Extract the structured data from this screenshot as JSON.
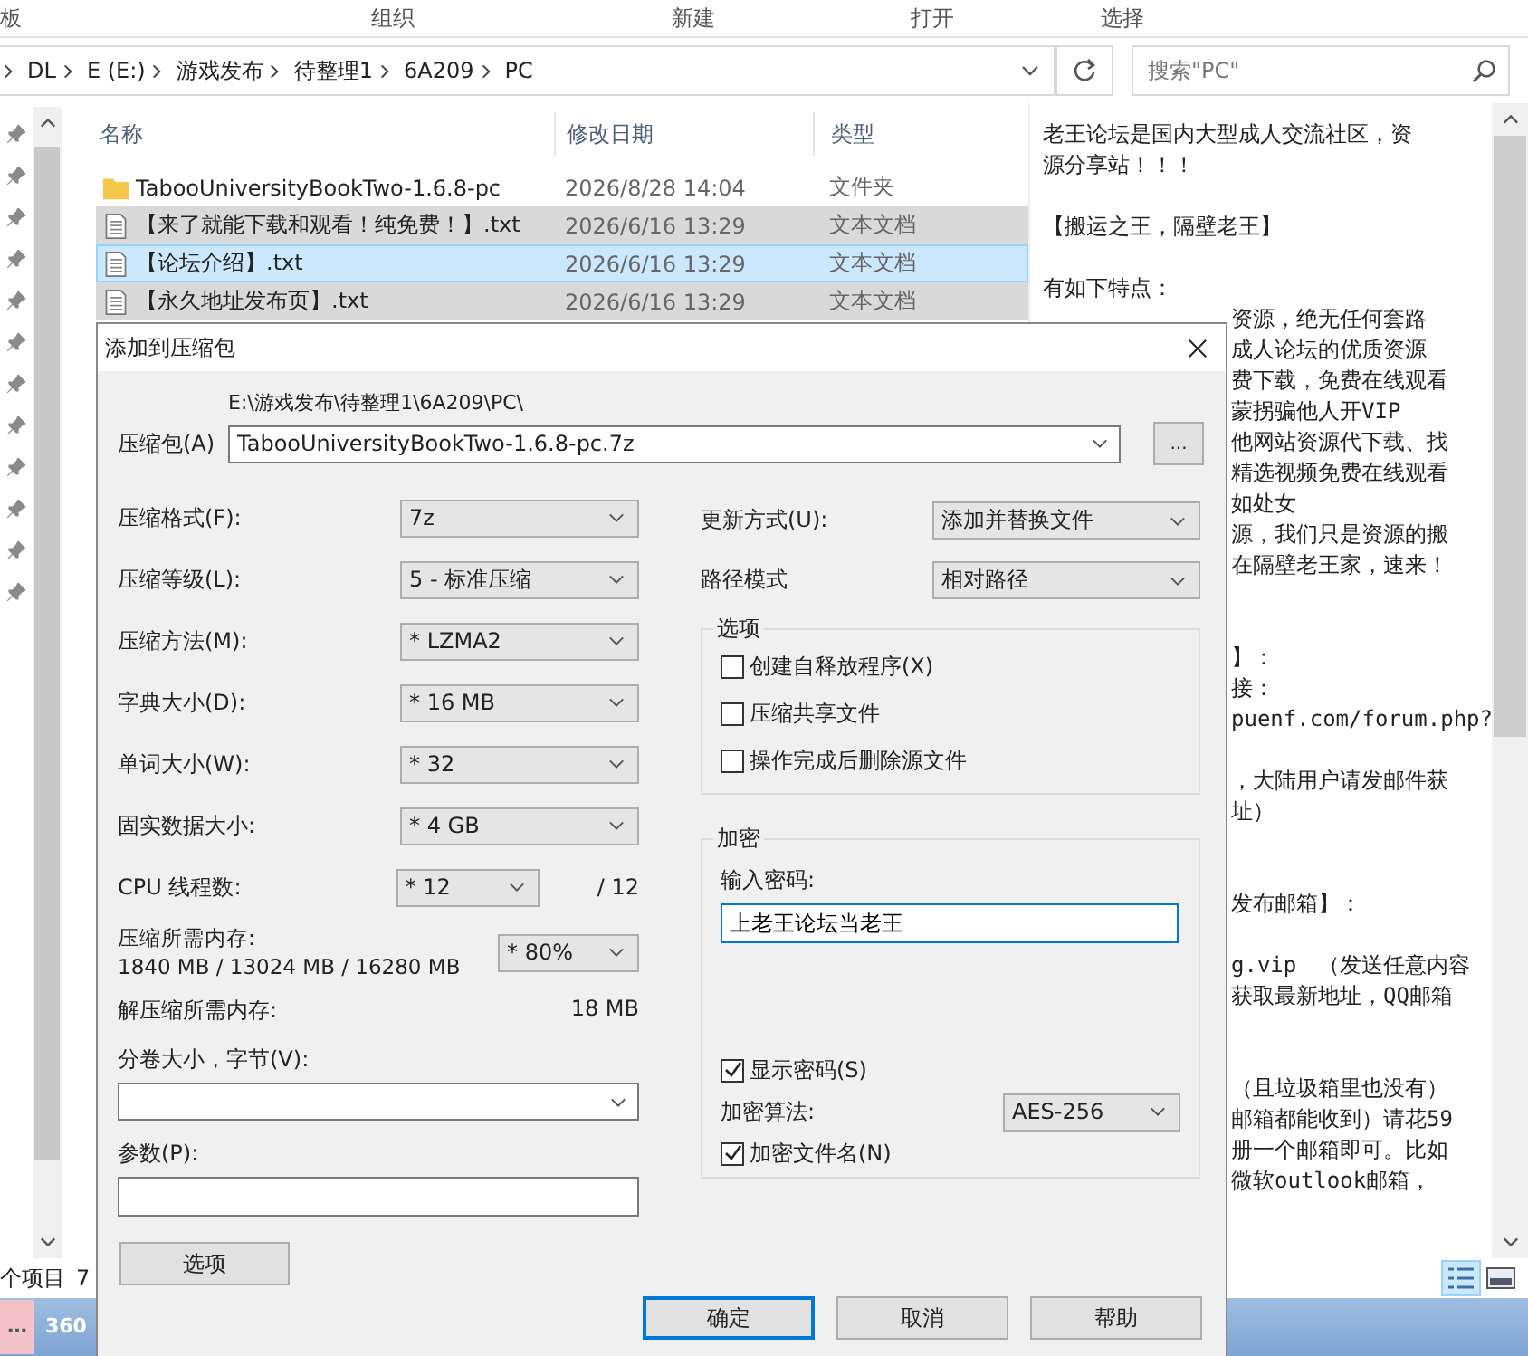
{
  "ribbon": {
    "groups": [
      "板",
      "组织",
      "新建",
      "打开",
      "选择"
    ]
  },
  "address_bar": {
    "crumbs": [
      "DL",
      "E (E:)",
      "游戏发布",
      "待整理1",
      "6A209",
      "PC"
    ],
    "search": {
      "placeholder": "搜索\"PC\""
    }
  },
  "file_list": {
    "columns": [
      "名称",
      "修改日期",
      "类型"
    ],
    "rows": [
      {
        "kind": "folder",
        "name": "TabooUniversityBookTwo-1.6.8-pc",
        "date": "2026/8/28 14:04",
        "type": "文件夹",
        "selected": false,
        "focused": false
      },
      {
        "kind": "text",
        "name": "【来了就能下载和观看！纯免费！】.txt",
        "date": "2026/6/16 13:29",
        "type": "文本文档",
        "selected": true,
        "focused": false
      },
      {
        "kind": "text",
        "name": "【论坛介绍】.txt",
        "date": "2026/6/16 13:29",
        "type": "文本文档",
        "selected": true,
        "focused": true
      },
      {
        "kind": "text",
        "name": "【永久地址发布页】.txt",
        "date": "2026/6/16 13:29",
        "type": "文本文档",
        "selected": true,
        "focused": false
      }
    ]
  },
  "preview": {
    "lines": [
      {
        "kind": "full",
        "text": "老王论坛是国内大型成人交流社区，资"
      },
      {
        "kind": "full",
        "text": "源分享站！！！"
      },
      {
        "kind": "blank"
      },
      {
        "kind": "full",
        "text": "【搬运之王，隔壁老王】"
      },
      {
        "kind": "blank"
      },
      {
        "kind": "full",
        "text": "有如下特点："
      },
      {
        "kind": "clipped",
        "text": "资源，绝无任何套路"
      },
      {
        "kind": "clipped",
        "text": "成人论坛的优质资源"
      },
      {
        "kind": "clipped",
        "text": "费下载，免费在线观看"
      },
      {
        "kind": "clipped",
        "text": "蒙拐骗他人开VIP"
      },
      {
        "kind": "clipped",
        "text": "他网站资源代下载、找"
      },
      {
        "kind": "clipped",
        "text": "精选视频免费在线观看"
      },
      {
        "kind": "clipped",
        "text": "如处女"
      },
      {
        "kind": "clipped",
        "text": "源，我们只是资源的搬"
      },
      {
        "kind": "clipped",
        "text": "在隔壁老王家，速来！"
      },
      {
        "kind": "blank"
      },
      {
        "kind": "blank"
      },
      {
        "kind": "clipped",
        "text": "】："
      },
      {
        "kind": "clipped",
        "text": "接："
      },
      {
        "kind": "clipped",
        "text": "puenf.com/forum.php?"
      },
      {
        "kind": "blank"
      },
      {
        "kind": "clipped",
        "text": "，大陆用户请发邮件获"
      },
      {
        "kind": "clipped",
        "text": "址）"
      },
      {
        "kind": "blank"
      },
      {
        "kind": "blank"
      },
      {
        "kind": "clipped",
        "text": "发布邮箱】："
      },
      {
        "kind": "blank"
      },
      {
        "kind": "clipped",
        "text": "g.vip　（发送任意内容"
      },
      {
        "kind": "clipped",
        "text": "获取最新地址，QQ邮箱"
      },
      {
        "kind": "blank"
      },
      {
        "kind": "blank"
      },
      {
        "kind": "clipped",
        "text": "（且垃圾箱里也没有）"
      },
      {
        "kind": "clipped",
        "text": "邮箱都能收到）请花59"
      },
      {
        "kind": "clipped",
        "text": "册一个邮箱即可。比如"
      },
      {
        "kind": "clipped",
        "text": "微软outlook邮箱，"
      }
    ]
  },
  "status_bar": {
    "items": [
      "个项目",
      "7"
    ]
  },
  "taskbar": {
    "items": [
      {
        "label": "…",
        "active": true
      },
      {
        "label": "360",
        "active": false
      }
    ]
  },
  "dialog": {
    "title": "添加到压缩包",
    "archive": {
      "label": "压缩包(A)",
      "path": "E:\\游戏发布\\待整理1\\6A209\\PC\\",
      "value": "TabooUniversityBookTwo-1.6.8-pc.7z",
      "browse": "..."
    },
    "left_fields": [
      {
        "kind": "select",
        "label": "压缩格式(F):",
        "value": "7z"
      },
      {
        "kind": "select",
        "label": "压缩等级(L):",
        "value": "5 - 标准压缩"
      },
      {
        "kind": "select",
        "label": "压缩方法(M):",
        "value": "* LZMA2"
      },
      {
        "kind": "select",
        "label": "字典大小(D):",
        "value": "* 16 MB"
      },
      {
        "kind": "select",
        "label": "单词大小(W):",
        "value": "* 32"
      },
      {
        "kind": "select",
        "label": "固实数据大小:",
        "value": "* 4 GB"
      },
      {
        "kind": "threads",
        "label": "CPU 线程数:",
        "value": "* 12",
        "suffix": "/ 12"
      },
      {
        "kind": "memory",
        "label": "压缩所需内存:",
        "detail": "1840 MB / 13024 MB / 16280 MB",
        "value": "* 80%"
      },
      {
        "kind": "info",
        "label": "解压缩所需内存:",
        "value": "18 MB"
      },
      {
        "kind": "combo",
        "label": "分卷大小，字节(V):"
      },
      {
        "kind": "input",
        "label": "参数(P):"
      }
    ],
    "options_button": "选项",
    "right_fields": [
      {
        "label": "更新方式(U):",
        "value": "添加并替换文件"
      },
      {
        "label": "路径模式",
        "value": "相对路径"
      }
    ],
    "options_group": {
      "title": "选项",
      "checkboxes": [
        {
          "label": "创建自释放程序(X)",
          "checked": false
        },
        {
          "label": "压缩共享文件",
          "checked": false
        },
        {
          "label": "操作完成后删除源文件",
          "checked": false
        }
      ]
    },
    "encryption": {
      "title": "加密",
      "password_label": "输入密码:",
      "password": "上老王论坛当老王",
      "show_password": {
        "label": "显示密码(S)",
        "checked": true
      },
      "method_label": "加密算法:",
      "method": "AES-256",
      "encrypt_names": {
        "label": "加密文件名(N)",
        "checked": true
      }
    },
    "buttons": [
      {
        "label": "确定",
        "default": true
      },
      {
        "label": "取消",
        "default": false
      },
      {
        "label": "帮助",
        "default": false
      }
    ]
  }
}
